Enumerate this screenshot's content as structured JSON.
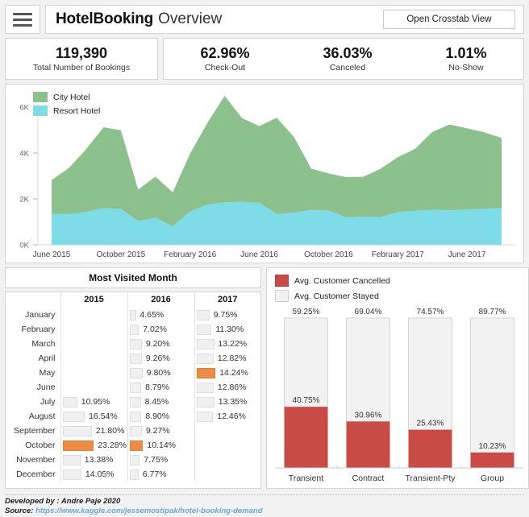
{
  "header": {
    "menu_icon": "hamburger-menu-icon",
    "title_strong": "HotelBooking",
    "title_light": "Overview",
    "crosstab_button": "Open Crosstab View"
  },
  "kpis": {
    "total": {
      "value": "119,390",
      "label": "Total Number of Bookings"
    },
    "items": [
      {
        "value": "62.96%",
        "label": "Check-Out"
      },
      {
        "value": "36.03%",
        "label": "Canceled"
      },
      {
        "value": "1.01%",
        "label": "No-Show"
      }
    ]
  },
  "colors": {
    "city_hotel": "#8cc18d",
    "resort_hotel": "#7edbe8",
    "cancelled": "#c94b45",
    "stayed": "#f2f2f2",
    "highlight": "#ee8c46",
    "bar_grey": "#f0f0f0",
    "axis": "#888888"
  },
  "area_chart": {
    "legend": [
      {
        "label": "City Hotel",
        "color": "#8cc18d"
      },
      {
        "label": "Resort Hotel",
        "color": "#7edbe8"
      }
    ],
    "ytick_labels": [
      "6K",
      "4K",
      "2K",
      "0K"
    ],
    "xtick_labels": [
      "June 2015",
      "October 2015",
      "February 2016",
      "June 2016",
      "October 2016",
      "February 2017",
      "June 2017"
    ]
  },
  "chart_data": [
    {
      "type": "area",
      "title": "Monthly Bookings by Hotel Type",
      "stacked": true,
      "xlabel": "",
      "ylabel": "",
      "ylim": [
        0,
        6000
      ],
      "ytick_values": [
        0,
        2000,
        4000,
        6000
      ],
      "ytick_labels": [
        "0K",
        "2K",
        "4K",
        "6K"
      ],
      "grid": false,
      "legend_position": "top-left",
      "x": [
        "June 2015",
        "July 2015",
        "August 2015",
        "September 2015",
        "October 2015",
        "November 2015",
        "December 2015",
        "January 2016",
        "February 2016",
        "March 2016",
        "April 2016",
        "May 2016",
        "June 2016",
        "July 2016",
        "August 2016",
        "September 2016",
        "October 2016",
        "November 2016",
        "December 2016",
        "January 2017",
        "February 2017",
        "March 2017",
        "April 2017",
        "May 2017",
        "June 2017",
        "July 2017",
        "August 2017"
      ],
      "series": [
        {
          "name": "Resort Hotel",
          "color": "#7edbe8",
          "values": [
            1350,
            1330,
            1430,
            1600,
            1560,
            1040,
            1180,
            810,
            1450,
            1760,
            1850,
            1870,
            1830,
            1340,
            1400,
            1520,
            1490,
            1200,
            1230,
            1210,
            1420,
            1480,
            1530,
            1500,
            1540,
            1570,
            1600
          ]
        },
        {
          "name": "City Hotel",
          "color": "#8cc18d",
          "values": [
            1470,
            2020,
            2740,
            3520,
            3430,
            1370,
            1790,
            1480,
            2520,
            3550,
            4640,
            3650,
            3340,
            4200,
            3300,
            1800,
            1620,
            1750,
            1730,
            2100,
            2400,
            2700,
            3390,
            3740,
            3540,
            3330,
            3060
          ]
        }
      ]
    },
    {
      "type": "bar",
      "title": "Avg. Customer Cancelled vs Stayed by Customer Type",
      "stacked": true,
      "categories": [
        "Transient",
        "Contract",
        "Transient-Pty",
        "Group"
      ],
      "ylim": [
        0,
        100
      ],
      "grid": false,
      "legend_position": "top-left",
      "series": [
        {
          "name": "Avg. Customer Cancelled",
          "color": "#c94b45",
          "values": [
            40.75,
            30.96,
            25.43,
            10.23
          ],
          "labels": [
            "40.75%",
            "30.96%",
            "25.43%",
            "10.23%"
          ]
        },
        {
          "name": "Avg. Customer Stayed",
          "color": "#f2f2f2",
          "values": [
            59.25,
            69.04,
            74.57,
            89.77
          ],
          "labels": [
            "59.25%",
            "69.04%",
            "74.57%",
            "89.77%"
          ]
        }
      ]
    }
  ],
  "most_visited": {
    "title": "Most Visited Month",
    "columns": [
      "",
      "2015",
      "2016",
      "2017"
    ],
    "rows": [
      {
        "month": "January",
        "cells": [
          {
            "value": null,
            "pct": null,
            "hl": false
          },
          {
            "value": "4.65%",
            "pct": 4.65,
            "hl": false
          },
          {
            "value": "9.75%",
            "pct": 9.75,
            "hl": false
          }
        ]
      },
      {
        "month": "February",
        "cells": [
          {
            "value": null,
            "pct": null,
            "hl": false
          },
          {
            "value": "7.02%",
            "pct": 7.02,
            "hl": false
          },
          {
            "value": "11.30%",
            "pct": 11.3,
            "hl": false
          }
        ]
      },
      {
        "month": "March",
        "cells": [
          {
            "value": null,
            "pct": null,
            "hl": false
          },
          {
            "value": "9.20%",
            "pct": 9.2,
            "hl": false
          },
          {
            "value": "13.22%",
            "pct": 13.22,
            "hl": false
          }
        ]
      },
      {
        "month": "April",
        "cells": [
          {
            "value": null,
            "pct": null,
            "hl": false
          },
          {
            "value": "9.26%",
            "pct": 9.26,
            "hl": false
          },
          {
            "value": "12.82%",
            "pct": 12.82,
            "hl": false
          }
        ]
      },
      {
        "month": "May",
        "cells": [
          {
            "value": null,
            "pct": null,
            "hl": false
          },
          {
            "value": "9.80%",
            "pct": 9.8,
            "hl": false
          },
          {
            "value": "14.24%",
            "pct": 14.24,
            "hl": true
          }
        ]
      },
      {
        "month": "June",
        "cells": [
          {
            "value": null,
            "pct": null,
            "hl": false
          },
          {
            "value": "8.79%",
            "pct": 8.79,
            "hl": false
          },
          {
            "value": "12.86%",
            "pct": 12.86,
            "hl": false
          }
        ]
      },
      {
        "month": "July",
        "cells": [
          {
            "value": "10.95%",
            "pct": 10.95,
            "hl": false
          },
          {
            "value": "8.45%",
            "pct": 8.45,
            "hl": false
          },
          {
            "value": "13.35%",
            "pct": 13.35,
            "hl": false
          }
        ]
      },
      {
        "month": "August",
        "cells": [
          {
            "value": "16.54%",
            "pct": 16.54,
            "hl": false
          },
          {
            "value": "8.90%",
            "pct": 8.9,
            "hl": false
          },
          {
            "value": "12.46%",
            "pct": 12.46,
            "hl": false
          }
        ]
      },
      {
        "month": "September",
        "cells": [
          {
            "value": "21.80%",
            "pct": 21.8,
            "hl": false
          },
          {
            "value": "9.27%",
            "pct": 9.27,
            "hl": false
          },
          {
            "value": null,
            "pct": null,
            "hl": false
          }
        ]
      },
      {
        "month": "October",
        "cells": [
          {
            "value": "23.28%",
            "pct": 23.28,
            "hl": true
          },
          {
            "value": "10.14%",
            "pct": 10.14,
            "hl": true
          },
          {
            "value": null,
            "pct": null,
            "hl": false
          }
        ]
      },
      {
        "month": "November",
        "cells": [
          {
            "value": "13.38%",
            "pct": 13.38,
            "hl": false
          },
          {
            "value": "7.75%",
            "pct": 7.75,
            "hl": false
          },
          {
            "value": null,
            "pct": null,
            "hl": false
          }
        ]
      },
      {
        "month": "December",
        "cells": [
          {
            "value": "14.05%",
            "pct": 14.05,
            "hl": false
          },
          {
            "value": "6.77%",
            "pct": 6.77,
            "hl": false
          },
          {
            "value": null,
            "pct": null,
            "hl": false
          }
        ]
      }
    ]
  },
  "bar_chart": {
    "legend": [
      {
        "label": "Avg. Customer Cancelled",
        "color": "#c94b45"
      },
      {
        "label": "Avg. Customer Stayed",
        "color": "#f2f2f2"
      }
    ]
  },
  "footer": {
    "developed_by": "Developed by : Andre Paje 2020",
    "source_label": "Source:",
    "source_url": "https://www.kaggle.com/jessemostipak/hotel-booking-demand"
  }
}
